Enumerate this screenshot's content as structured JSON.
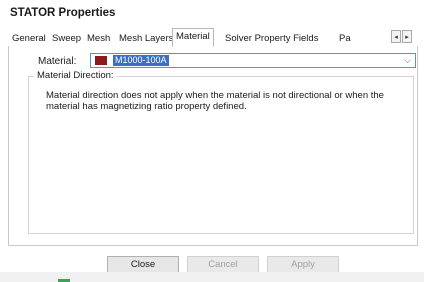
{
  "window": {
    "title": "STATOR Properties"
  },
  "tabs": [
    {
      "label": "General"
    },
    {
      "label": "Sweep"
    },
    {
      "label": "Mesh"
    },
    {
      "label": "Mesh Layers"
    },
    {
      "label": "Material"
    },
    {
      "label": "Solver Property Fields"
    },
    {
      "label": "Pa"
    }
  ],
  "active_tab": "Material",
  "tab_scroll": {
    "left": "◂",
    "right": "▸"
  },
  "material": {
    "label": "Material:",
    "value": "M1000-100A",
    "swatch_color": "#8b1a1a",
    "dropdown_icon": "⌵"
  },
  "material_direction": {
    "title": "Material Direction:",
    "description": "Material direction does not apply when the material is not directional or when the material has magnetizing ratio property defined."
  },
  "buttons": {
    "close": "Close",
    "cancel": "Cancel",
    "apply": "Apply"
  }
}
